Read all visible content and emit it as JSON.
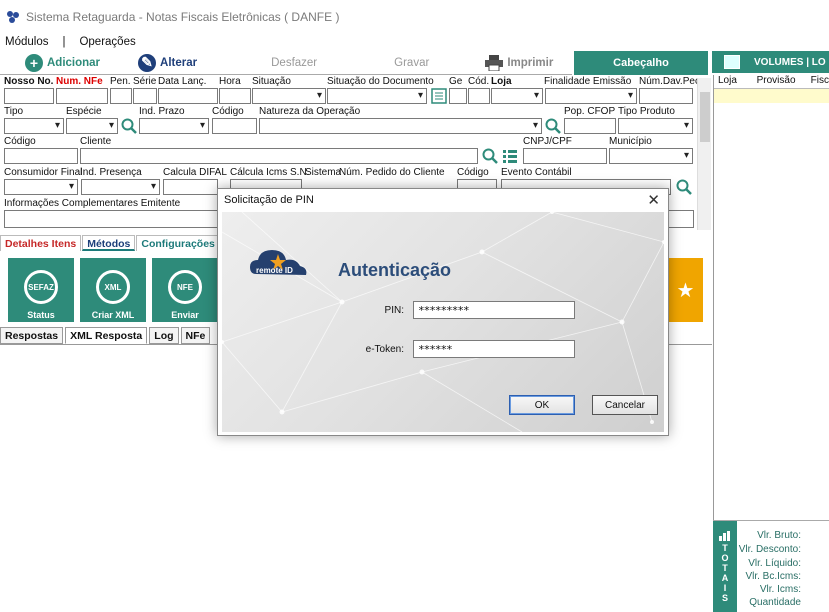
{
  "window": {
    "title": "Sistema Retaguarda - Notas Fiscais Eletrônicas ( DANFE )"
  },
  "menu": {
    "items": [
      "Módulos",
      "Operações"
    ],
    "separator": "|"
  },
  "toolbar": {
    "add": "Adicionar",
    "edit": "Alterar",
    "undo": "Desfazer",
    "save": "Gravar",
    "print": "Imprimir"
  },
  "tabs_right": {
    "header": "Cabeçalho",
    "volumes": "VOLUMES | LO"
  },
  "form": {
    "row1": [
      "Nosso No.",
      "Num. NFe",
      "Pen.",
      "Série",
      "Data Lanç.",
      "Hora",
      "Situação",
      "Situação do Documento",
      "Ge",
      "Cód.",
      "Loja",
      "Finalidade Emissão",
      "Núm.Dav.Pec"
    ],
    "row2": [
      "Tipo",
      "Espécie",
      "Ind. Prazo",
      "Código",
      "Natureza da Operação",
      "Pop. CFOP",
      "Tipo Produto"
    ],
    "row3": [
      "Código",
      "Cliente",
      "CNPJ/CPF",
      "Município"
    ],
    "row4": [
      "Consumidor Final",
      "Ind. Presença",
      "Calcula DIFAL",
      "Cálcula Icms S.N.",
      "Sistema",
      "Núm. Pedido do Cliente",
      "Código",
      "Evento Contábil"
    ],
    "row5": [
      "Informações Complementares Emitente"
    ]
  },
  "right_grid": {
    "columns": [
      "Loja",
      "Provisão",
      "Fisc"
    ]
  },
  "subtabs": [
    "Detalhes Itens",
    "Métodos",
    "Configurações",
    "I"
  ],
  "big_buttons": [
    {
      "icon": "SEFAZ",
      "label": "Status"
    },
    {
      "icon": "XML",
      "label": "Criar XML"
    },
    {
      "icon": "NFE",
      "label": "Enviar"
    }
  ],
  "lower_tabs": [
    "Respostas",
    "XML Resposta",
    "Log",
    "NFe"
  ],
  "totais": {
    "bar": [
      "T",
      "O",
      "T",
      "A",
      "I",
      "S"
    ],
    "rows": [
      "Vlr. Bruto:",
      "Vlr. Desconto:",
      "Vlr. Líquido:",
      "Vlr. Bc.Icms:",
      "Vlr. Icms:",
      "Quantidade"
    ]
  },
  "dialog": {
    "title": "Solicitação de PIN",
    "logo_text": "remote ID",
    "heading": "Autenticação",
    "pin_label": "PIN:",
    "pin_value": "*********",
    "token_label": "e-Token:",
    "token_value": "******",
    "ok": "OK",
    "cancel": "Cancelar"
  },
  "colors": {
    "teal": "#2e8b7a",
    "orange": "#f0a500",
    "dialog_heading": "#2c4d7a"
  }
}
